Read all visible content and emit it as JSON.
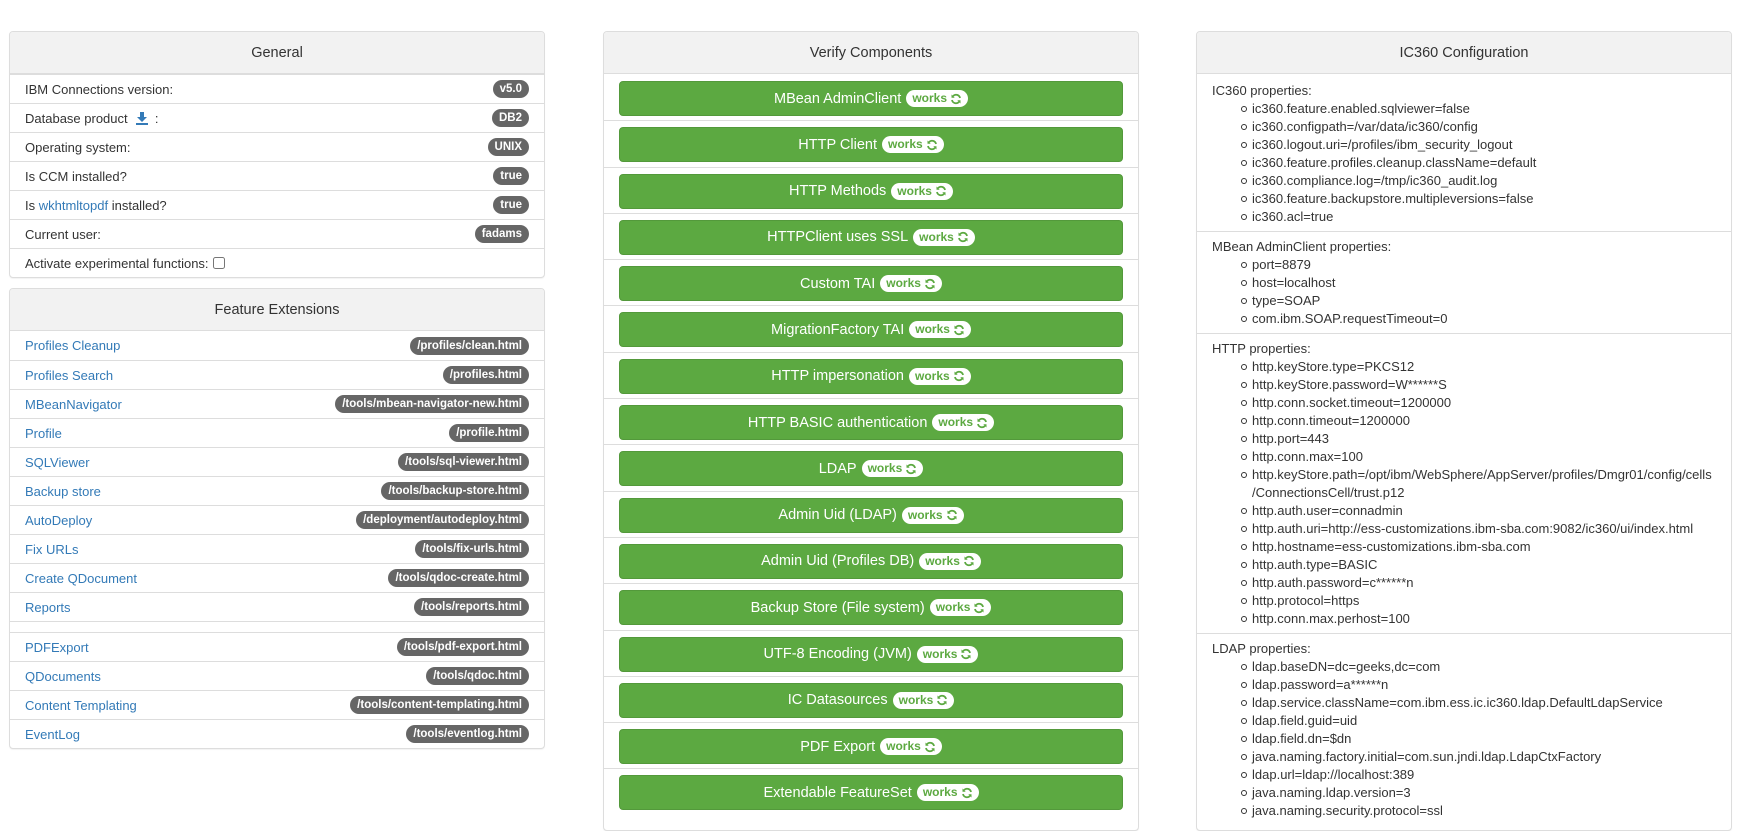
{
  "general": {
    "title": "General",
    "rows": [
      {
        "label": "IBM Connections version:",
        "value": "v5.0"
      },
      {
        "label": "Database product",
        "suffix": ":",
        "icon": "download-icon",
        "value": "DB2"
      },
      {
        "label": "Operating system:",
        "value": "UNIX"
      },
      {
        "label": "Is CCM installed?",
        "value": "true"
      },
      {
        "label_prefix": "Is ",
        "link": "wkhtmltopdf",
        "label_suffix": " installed?",
        "value": "true"
      },
      {
        "label": "Current user:",
        "value": "fadams"
      },
      {
        "label": "Activate experimental functions:",
        "checkbox": false
      }
    ]
  },
  "features": {
    "title": "Feature Extensions",
    "items": [
      {
        "label": "Profiles Cleanup",
        "path": "/profiles/clean.html"
      },
      {
        "label": "Profiles Search",
        "path": "/profiles.html"
      },
      {
        "label": "MBeanNavigator",
        "path": "/tools/mbean-navigator-new.html"
      },
      {
        "label": "Profile",
        "path": "/profile.html"
      },
      {
        "label": "SQLViewer",
        "path": "/tools/sql-viewer.html"
      },
      {
        "label": "Backup store",
        "path": "/tools/backup-store.html"
      },
      {
        "label": "AutoDeploy",
        "path": "/deployment/autodeploy.html"
      },
      {
        "label": "Fix URLs",
        "path": "/tools/fix-urls.html"
      },
      {
        "label": "Create QDocument",
        "path": "/tools/qdoc-create.html"
      },
      {
        "label": "Reports",
        "path": "/tools/reports.html"
      },
      {
        "label": "PDFExport",
        "path": "/tools/pdf-export.html"
      },
      {
        "label": "QDocuments",
        "path": "/tools/qdoc.html"
      },
      {
        "label": "Content Templating",
        "path": "/tools/content-templating.html"
      },
      {
        "label": "EventLog",
        "path": "/tools/eventlog.html"
      }
    ]
  },
  "verify": {
    "title": "Verify Components",
    "status_label": "works",
    "status_icon": "refresh-icon",
    "colors": {
      "button": "#5ca941",
      "badge_bg": "#ffffff"
    },
    "components": [
      "MBean AdminClient",
      "HTTP Client",
      "HTTP Methods",
      "HTTPClient uses SSL",
      "Custom TAI",
      "MigrationFactory TAI",
      "HTTP impersonation",
      "HTTP BASIC authentication",
      "LDAP",
      "Admin Uid (LDAP)",
      "Admin Uid (Profiles DB)",
      "Backup Store (File system)",
      "UTF-8 Encoding (JVM)",
      "IC Datasources",
      "PDF Export",
      "Extendable FeatureSet"
    ]
  },
  "config": {
    "title": "IC360 Configuration",
    "groups": [
      {
        "title": "IC360 properties:",
        "items": [
          "ic360.feature.enabled.sqlviewer=false",
          "ic360.configpath=/var/data/ic360/config",
          "ic360.logout.uri=/profiles/ibm_security_logout",
          "ic360.feature.profiles.cleanup.className=default",
          "ic360.compliance.log=/tmp/ic360_audit.log",
          "ic360.feature.backupstore.multipleversions=false",
          "ic360.acl=true"
        ]
      },
      {
        "title": "MBean AdminClient properties:",
        "items": [
          "port=8879",
          "host=localhost",
          "type=SOAP",
          "com.ibm.SOAP.requestTimeout=0"
        ]
      },
      {
        "title": "HTTP properties:",
        "items": [
          "http.keyStore.type=PKCS12",
          "http.keyStore.password=W******S",
          "http.conn.socket.timeout=1200000",
          "http.conn.timeout=1200000",
          "http.port=443",
          "http.conn.max=100",
          "http.keyStore.path=/opt/ibm/WebSphere/AppServer/profiles/Dmgr01/config/cells /ConnectionsCell/trust.p12",
          "http.auth.user=connadmin",
          "http.auth.uri=http://ess-customizations.ibm-sba.com:9082/ic360/ui/index.html",
          "http.hostname=ess-customizations.ibm-sba.com",
          "http.auth.type=BASIC",
          "http.auth.password=c******n",
          "http.protocol=https",
          "http.conn.max.perhost=100"
        ]
      },
      {
        "title": "LDAP properties:",
        "items": [
          "ldap.baseDN=dc=geeks,dc=com",
          "ldap.password=a******n",
          "ldap.service.className=com.ibm.ess.ic.ic360.ldap.DefaultLdapService",
          "ldap.field.guid=uid",
          "ldap.field.dn=$dn",
          "java.naming.factory.initial=com.sun.jndi.ldap.LdapCtxFactory",
          "ldap.url=ldap://localhost:389",
          "java.naming.ldap.version=3",
          "java.naming.security.protocol=ssl"
        ]
      }
    ]
  }
}
